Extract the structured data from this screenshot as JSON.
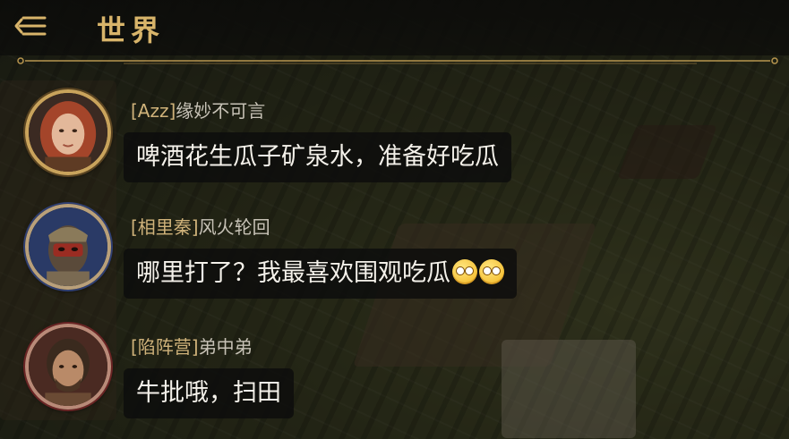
{
  "header": {
    "title": "世界",
    "back_icon": "back-menu-icon"
  },
  "messages": [
    {
      "alliance": "[Azz]",
      "name": "缘妙不可言",
      "text": "啤酒花生瓜子矿泉水，准备好吃瓜",
      "avatar": "avatar-red-haired-woman",
      "emojis": 0
    },
    {
      "alliance": "[相里秦]",
      "name": "风火轮回",
      "text": "哪里打了？我最喜欢围观吃瓜",
      "avatar": "avatar-masked-warrior",
      "emojis": 2
    },
    {
      "alliance": "[陷阵营]",
      "name": "弟中弟",
      "text": "牛批哦，扫田",
      "avatar": "avatar-bearded-man",
      "emojis": 0
    }
  ],
  "colors": {
    "accent_gold": "#d8b46a",
    "bubble_bg": "#0c0c0c",
    "text_main": "#f4f1ea"
  }
}
